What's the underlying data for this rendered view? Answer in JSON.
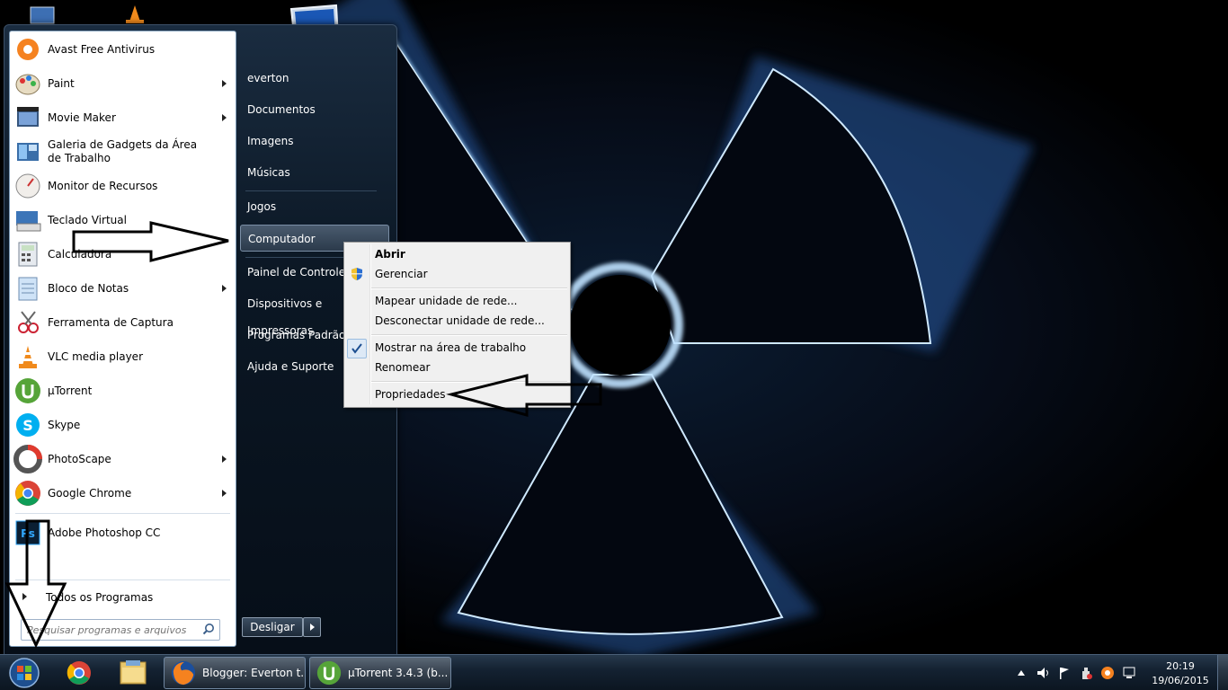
{
  "desktop": {
    "icons": [
      "computer-icon",
      "vlc-icon",
      "folder-icon"
    ]
  },
  "start_menu": {
    "programs": [
      {
        "label": "Avast Free Antivirus",
        "icon": "avast-icon",
        "submenu": false
      },
      {
        "label": "Paint",
        "icon": "paint-icon",
        "submenu": true
      },
      {
        "label": "Movie Maker",
        "icon": "movie-maker-icon",
        "submenu": true
      },
      {
        "label": "Galeria de Gadgets da Área de Trabalho",
        "icon": "gadgets-icon",
        "submenu": false
      },
      {
        "label": "Monitor de Recursos",
        "icon": "resource-monitor-icon",
        "submenu": false
      },
      {
        "label": "Teclado Virtual",
        "icon": "keyboard-icon",
        "submenu": false
      },
      {
        "label": "Calculadora",
        "icon": "calculator-icon",
        "submenu": false
      },
      {
        "label": "Bloco de Notas",
        "icon": "notepad-icon",
        "submenu": true
      },
      {
        "label": "Ferramenta de Captura",
        "icon": "snipping-tool-icon",
        "submenu": false
      },
      {
        "label": "VLC media player",
        "icon": "vlc-icon",
        "submenu": false
      },
      {
        "label": "µTorrent",
        "icon": "utorrent-icon",
        "submenu": false
      },
      {
        "label": "Skype",
        "icon": "skype-icon",
        "submenu": false
      },
      {
        "label": "PhotoScape",
        "icon": "photoscape-icon",
        "submenu": true
      },
      {
        "label": "Google Chrome",
        "icon": "chrome-icon",
        "submenu": true
      },
      {
        "label": "Adobe Photoshop CC",
        "icon": "photoshop-icon",
        "submenu": false
      }
    ],
    "all_programs": "Todos os Programas",
    "search_placeholder": "Pesquisar programas e arquivos",
    "right_links": [
      "everton",
      "Documentos",
      "Imagens",
      "Músicas",
      "Jogos",
      "Computador",
      "Painel de Controle",
      "Dispositivos e Impressoras",
      "Programas Padrão",
      "Ajuda e Suporte"
    ],
    "shutdown_label": "Desligar"
  },
  "context_menu": {
    "items": [
      {
        "label": "Abrir",
        "bold": true
      },
      {
        "label": "Gerenciar",
        "icon": "uac-shield-icon"
      },
      {
        "label": "Mapear unidade de rede..."
      },
      {
        "label": "Desconectar unidade de rede..."
      },
      {
        "label": "Mostrar na área de trabalho",
        "checked": true
      },
      {
        "label": "Renomear"
      },
      {
        "label": "Propriedades"
      }
    ]
  },
  "taskbar": {
    "pinned": [
      "chrome-icon",
      "explorer-icon"
    ],
    "tasks": [
      {
        "label": "Blogger: Everton t...",
        "icon": "firefox-icon"
      },
      {
        "label": "µTorrent 3.4.3  (b...",
        "icon": "utorrent-icon"
      }
    ],
    "clock_time": "20:19",
    "clock_date": "19/06/2015"
  }
}
